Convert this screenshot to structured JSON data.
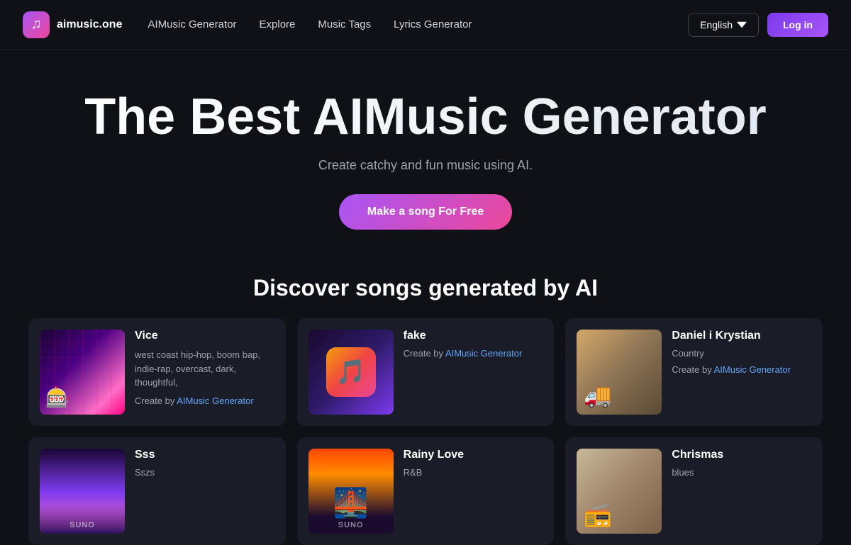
{
  "nav": {
    "logo_text": "aimusic.one",
    "links": [
      {
        "label": "AIMusic Generator",
        "id": "aimusic-generator"
      },
      {
        "label": "Explore",
        "id": "explore"
      },
      {
        "label": "Music Tags",
        "id": "music-tags"
      },
      {
        "label": "Lyrics Generator",
        "id": "lyrics-generator"
      }
    ],
    "language": "English",
    "login_label": "Log in"
  },
  "hero": {
    "title": "The Best AIMusic Generator",
    "subtitle": "Create catchy and fun music using AI.",
    "cta_label": "Make a song For Free"
  },
  "discover": {
    "heading": "Discover songs generated by AI",
    "songs": [
      {
        "id": "vice",
        "title": "Vice",
        "desc": "west coast hip-hop, boom bap, indie-rap, overcast, dark, thoughtful,",
        "create_by": "Create by",
        "creator": "AIMusic Generator",
        "thumb_type": "vice"
      },
      {
        "id": "fake",
        "title": "fake",
        "desc": "",
        "create_by": "Create by",
        "creator": "AIMusic Generator",
        "thumb_type": "fake"
      },
      {
        "id": "daniel",
        "title": "Daniel i Krystian",
        "genre": "Country",
        "create_by": "Create by",
        "creator": "AIMusic Generator",
        "thumb_type": "daniel"
      },
      {
        "id": "sss",
        "title": "Sss",
        "genre": "Sszs",
        "thumb_type": "sss",
        "suno_label": "SUNO"
      },
      {
        "id": "rainy",
        "title": "Rainy Love",
        "genre": "R&B",
        "thumb_type": "rainy",
        "suno_label": "SUNO"
      },
      {
        "id": "chrismas",
        "title": "Chrismas",
        "genre": "blues",
        "thumb_type": "chrismas"
      }
    ]
  },
  "icons": {
    "music_note": "♫",
    "chevron_down": "▾"
  }
}
